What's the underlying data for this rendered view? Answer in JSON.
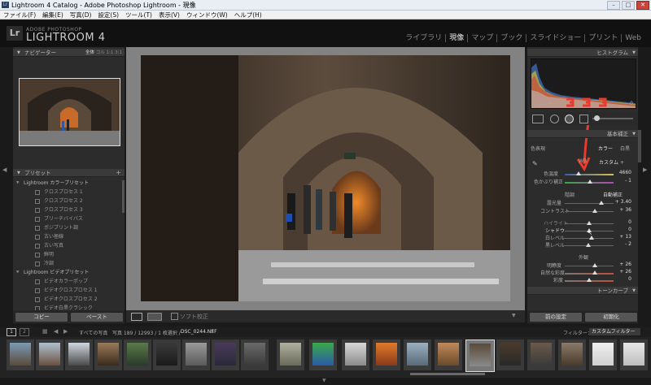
{
  "window": {
    "title": "Lightroom 4 Catalog - Adobe Photoshop Lightroom - 現像"
  },
  "menu": [
    "ファイル(F)",
    "編集(E)",
    "写真(D)",
    "設定(S)",
    "ツール(T)",
    "表示(V)",
    "ウィンドウ(W)",
    "ヘルプ(H)"
  ],
  "identity": {
    "adobe": "ADOBE PHOTOSHOP",
    "product": "LIGHTROOM 4",
    "logo": "Lr"
  },
  "modules": [
    {
      "label": "ライブラリ",
      "active": false
    },
    {
      "label": "現像",
      "active": true
    },
    {
      "label": "マップ",
      "active": false
    },
    {
      "label": "ブック",
      "active": false
    },
    {
      "label": "スライドショー",
      "active": false
    },
    {
      "label": "プリント",
      "active": false
    },
    {
      "label": "Web",
      "active": false
    }
  ],
  "navigator": {
    "title": "ナビゲーター",
    "zoom_fit": "全体",
    "zoom_fill": "コル",
    "zoom_1": "1:1",
    "zoom_other": "3:1"
  },
  "presets": {
    "title": "プリセット",
    "add": "+",
    "folders": [
      {
        "name": "Lightroom カラープリセット",
        "items": [
          "クロスプロセス 1",
          "クロスプロセス 2",
          "クロスプロセス 3",
          "ブリーチバイパス",
          "ポジプリント調",
          "古い極線",
          "古い写真",
          "鮮明",
          "冷調"
        ]
      },
      {
        "name": "Lightroom ビデオプリセット",
        "items": [
          "ビデオカラーポップ",
          "ビデオクロスプロセス 1",
          "ビデオクロスプロセス 2",
          "ビデオ白黒クラシック"
        ]
      }
    ]
  },
  "left_buttons": {
    "copy": "コピー",
    "paste": "ペースト"
  },
  "toolbar": {
    "soft_proof": "ソフト校正"
  },
  "right_panel": {
    "histogram_title": "ヒストグラム",
    "histogram_label": "シャドウ",
    "histogram_val": "0",
    "basic_title": "基本補正",
    "treatment_label": "色表現",
    "treatment_color": "カラー",
    "treatment_bw": "白黒",
    "wb_label": "WB",
    "wb_value": "カスタム ÷",
    "temp_label": "色温度",
    "temp_value": "4660",
    "tint_label": "色かぶり補正",
    "tint_value": "- 1",
    "tone_label": "階調",
    "auto_label": "自動補正",
    "exposure_label": "露光量",
    "exposure_value": "+ 3.40",
    "contrast_label": "コントラスト",
    "contrast_value": "+ 36",
    "highlights_label": "ハイライト",
    "highlights_value": "0",
    "shadows_label": "シャドウ",
    "shadows_value": "0",
    "whites_label": "白レベル",
    "whites_value": "+ 13",
    "blacks_label": "黒レベル",
    "blacks_value": "- 2",
    "presence_label": "外観",
    "clarity_label": "明瞭度",
    "clarity_value": "+ 26",
    "vibrance_label": "自然な彩度",
    "vibrance_value": "+ 26",
    "saturation_label": "彩度",
    "saturation_value": "0",
    "tone_curve_title": "トーンカーブ",
    "prev_button": "前の設定",
    "reset_button": "初期化"
  },
  "filmstrip": {
    "page1": "1",
    "page2": "2",
    "source": "すべての写真",
    "count": "写真 189 / 12993 / 1 枚選択 /",
    "filename": "DSC_0244.NEF",
    "filter_label": "フィルター：",
    "filter_value": "カスタムフィルター"
  },
  "colors": {
    "accent_red": "#e83a2e",
    "panel_bg": "#2c2c2c",
    "center_bg": "#828282"
  }
}
